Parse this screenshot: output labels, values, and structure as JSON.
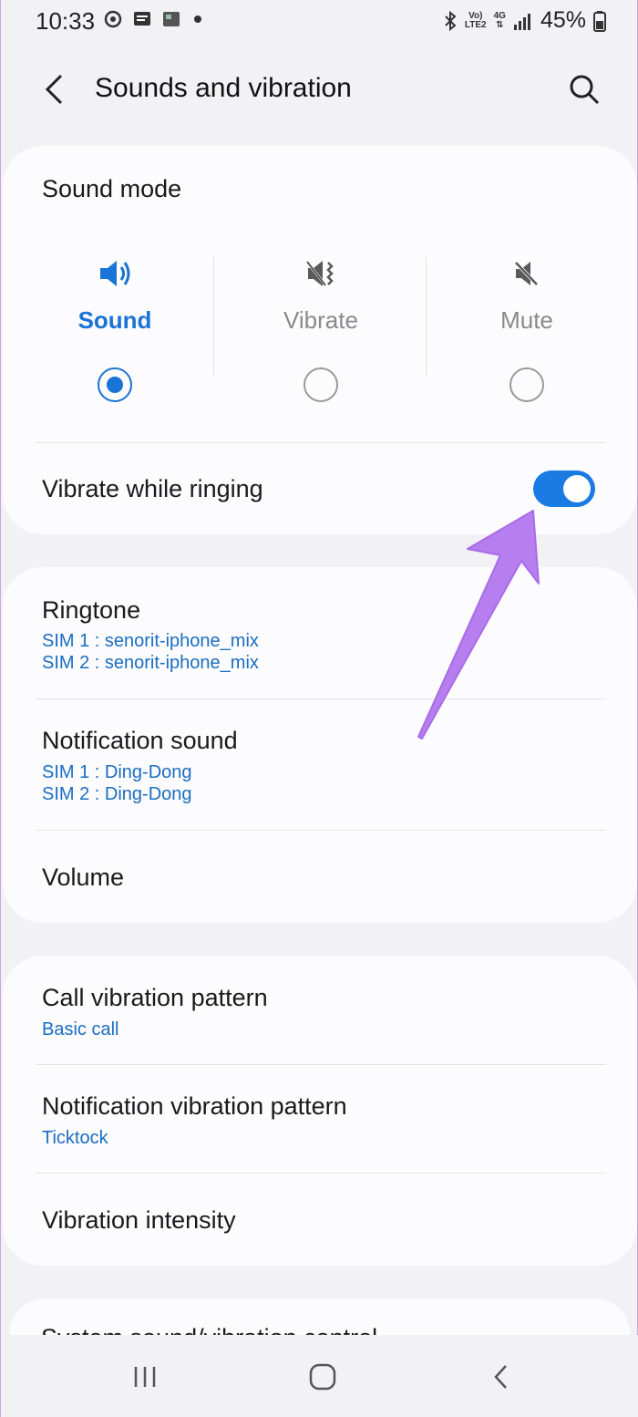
{
  "status_bar": {
    "time": "10:33",
    "battery": "45%",
    "network_top": "Vo)",
    "network_bottom": "LTE2",
    "signal_type": "4G"
  },
  "header": {
    "title": "Sounds and vibration",
    "back_icon": "back-arrow-icon",
    "search_icon": "search-icon"
  },
  "sound_mode": {
    "title": "Sound mode",
    "options": [
      {
        "label": "Sound",
        "icon": "speaker-icon",
        "selected": true
      },
      {
        "label": "Vibrate",
        "icon": "vibrate-icon",
        "selected": false
      },
      {
        "label": "Mute",
        "icon": "mute-icon",
        "selected": false
      }
    ],
    "vibrate_while_ringing": {
      "label": "Vibrate while ringing",
      "enabled": true
    }
  },
  "sounds": {
    "ringtone": {
      "title": "Ringtone",
      "sim1": "SIM 1 : senorit-iphone_mix",
      "sim2": "SIM 2 : senorit-iphone_mix"
    },
    "notification_sound": {
      "title": "Notification sound",
      "sim1": "SIM 1 : Ding-Dong",
      "sim2": "SIM 2 : Ding-Dong"
    },
    "volume": {
      "title": "Volume"
    }
  },
  "vibration": {
    "call_pattern": {
      "title": "Call vibration pattern",
      "value": "Basic call"
    },
    "notification_pattern": {
      "title": "Notification vibration pattern",
      "value": "Ticktock"
    },
    "intensity": {
      "title": "Vibration intensity"
    }
  },
  "partial": {
    "title": "System sound/vibration control"
  },
  "colors": {
    "accent": "#1a73d6",
    "annotation_arrow": "#b77ef0"
  },
  "nav": {
    "recents_icon": "recents-icon",
    "home_icon": "home-icon",
    "back_icon": "back-icon"
  }
}
